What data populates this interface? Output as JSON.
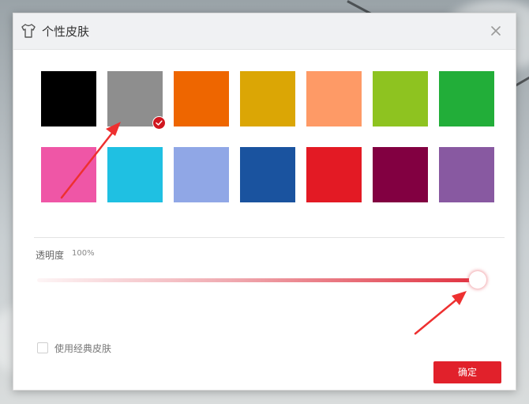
{
  "dialog": {
    "title": "个性皮肤",
    "title_icon": "tshirt-icon",
    "close_icon": "close-icon"
  },
  "swatches": [
    {
      "color": "#000000",
      "selected": false
    },
    {
      "color": "#8e8e8e",
      "selected": true
    },
    {
      "color": "#ee6600",
      "selected": false
    },
    {
      "color": "#dba605",
      "selected": false
    },
    {
      "color": "#fe9a66",
      "selected": false
    },
    {
      "color": "#8ec320",
      "selected": false
    },
    {
      "color": "#22ae39",
      "selected": false
    },
    {
      "color": "#ef56a6",
      "selected": false
    },
    {
      "color": "#1fc0e2",
      "selected": false
    },
    {
      "color": "#90a7e6",
      "selected": false
    },
    {
      "color": "#1a539f",
      "selected": false
    },
    {
      "color": "#e31a24",
      "selected": false
    },
    {
      "color": "#820041",
      "selected": false
    },
    {
      "color": "#8859a1",
      "selected": false
    }
  ],
  "opacity": {
    "label": "透明度",
    "value_text": "100%",
    "value": 100
  },
  "classic_skin": {
    "label": "使用经典皮肤",
    "checked": false
  },
  "confirm_label": "确定",
  "accent_color": "#e1212b"
}
